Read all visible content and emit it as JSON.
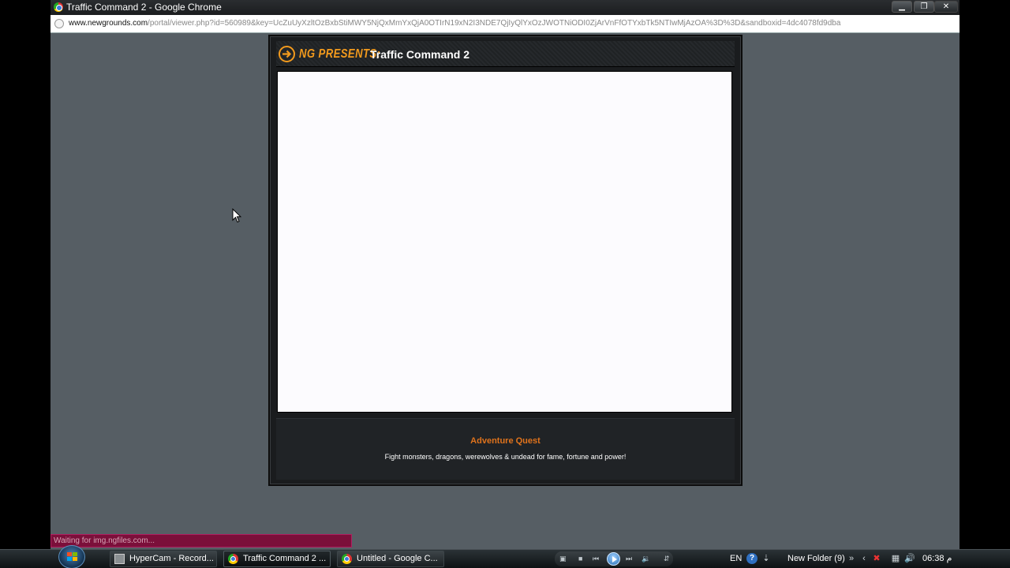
{
  "browser": {
    "window_title": "Traffic Command 2 - Google Chrome",
    "url_host": "www.newgrounds.com",
    "url_rest": "/portal/viewer.php?id=560989&key=UcZuUyXzltOzBxbStiMWY5NjQxMmYxQjA0OTIrN19xN2I3NDE7QjIyQlYxOzJWOTNiODI0ZjArVnFfOTYxbTk5NTIwMjAzOA%3D%3D&sandboxid=4dc4078fd9dba",
    "status_text": "Waiting for img.ngfiles.com..."
  },
  "ng": {
    "presents_label": "NG PRESENTS:",
    "game_title": "Traffic Command 2",
    "promo_title": "Adventure Quest",
    "promo_desc": "Fight monsters, dragons, werewolves & undead for fame, fortune and power!"
  },
  "taskbar": {
    "tasks": [
      {
        "label": "HyperCam - Record...",
        "icon": "hypercam-icon"
      },
      {
        "label": "Traffic Command 2 ...",
        "icon": "chrome-icon"
      },
      {
        "label": "Untitled - Google C...",
        "icon": "chrome-icon"
      }
    ],
    "language": "EN",
    "new_folder_label": "New Folder (9)",
    "time": "06:38",
    "time_suffix": "م"
  },
  "colors": {
    "desktop_bg": "#565e64",
    "ng_orange": "#f29a1d",
    "promo_title": "#e0731c",
    "status_bg": "#7b0f3a"
  }
}
